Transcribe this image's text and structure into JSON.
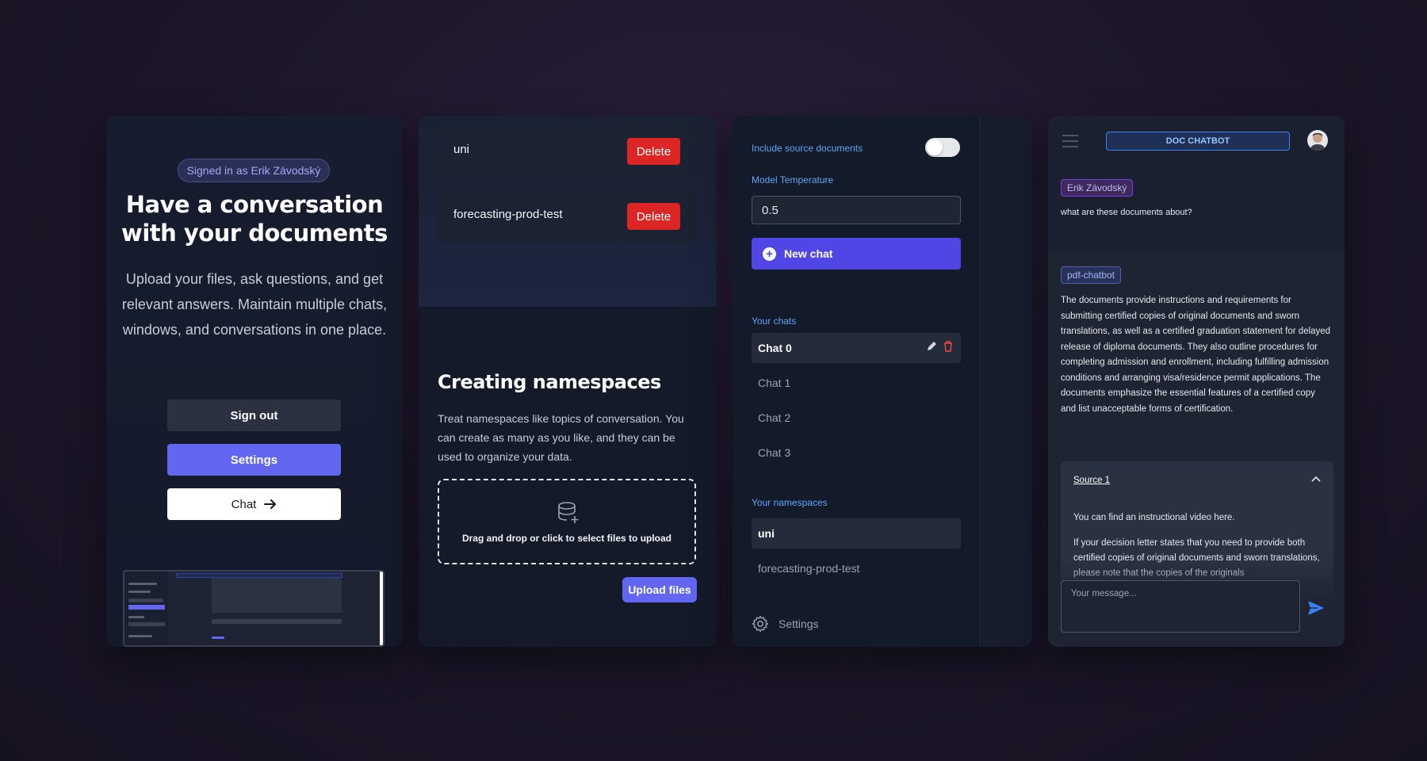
{
  "panel1": {
    "signed_in": "Signed in as Erik Závodský",
    "title": "Have a conversation with your documents",
    "subtitle": "Upload your files, ask questions, and get relevant answers. Maintain multiple chats, windows, and conversations in one place.",
    "sign_out": "Sign out",
    "settings": "Settings",
    "chat": "Chat",
    "chat_icon": "arrow-right-icon"
  },
  "panel2": {
    "namespaces": [
      {
        "name": "uni",
        "delete_label": "Delete"
      },
      {
        "name": "forecasting-prod-test",
        "delete_label": "Delete"
      }
    ],
    "heading": "Creating namespaces",
    "description": "Treat namespaces like topics of conversation. You can create as many as you like, and they can be used to organize your data.",
    "dropzone_text": "Drag and drop or click to select files to upload",
    "dropzone_icon": "database-add-icon",
    "upload_label": "Upload files"
  },
  "panel3": {
    "include_sources_label": "Include source documents",
    "include_sources_on": false,
    "temperature_label": "Model Temperature",
    "temperature_value": "0.5",
    "new_chat": "New chat",
    "your_chats_label": "Your chats",
    "chats": [
      "Chat 0",
      "Chat 1",
      "Chat 2",
      "Chat 3"
    ],
    "active_chat": "Chat 0",
    "your_namespaces_label": "Your namespaces",
    "namespaces": [
      "uni",
      "forecasting-prod-test"
    ],
    "active_namespace": "uni",
    "settings_label": "Settings"
  },
  "panel4": {
    "app_title": "DOC CHATBOT",
    "user_name": "Erik Závodský",
    "user_message": "what are these documents about?",
    "bot_name": "pdf-chatbot",
    "bot_message": "The documents provide instructions and requirements for submitting certified copies of original documents and sworn translations, as well as a certified graduation statement for delayed release of diploma documents. They also outline procedures for completing admission and enrollment, including fulfilling admission conditions and arranging visa/residence permit applications. The documents emphasize the essential features of a certified copy and list unacceptable forms of certification.",
    "source_title": "Source 1",
    "source_p1": "You can find an instructional video here.",
    "source_p2": "If your decision letter states that you need to provide both certified copies of original documents and sworn translations, please note that the copies of the originals",
    "input_placeholder": "Your message..."
  },
  "colors": {
    "accent": "#6366f1",
    "danger": "#dc2626",
    "link_blue": "#60a5fa"
  }
}
